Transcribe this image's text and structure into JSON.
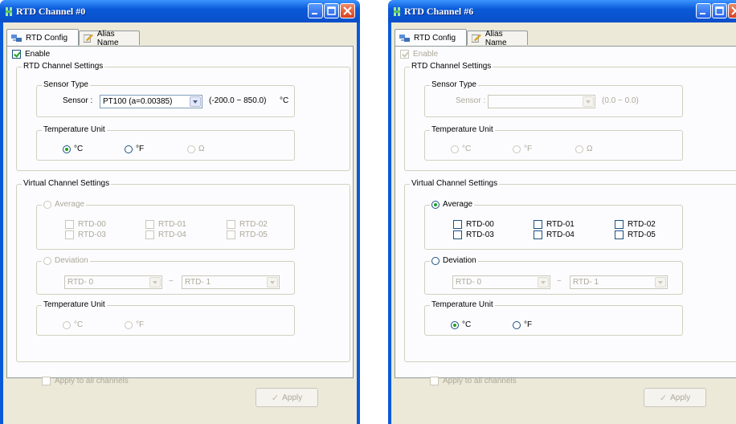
{
  "left_window": {
    "title": "RTD Channel #0",
    "tabs": [
      {
        "label": "RTD Config"
      },
      {
        "label": "Alias Name"
      }
    ],
    "enable_label": "Enable",
    "rtd_channel_settings": {
      "title": "RTD Channel Settings",
      "sensor_type": {
        "title": "Sensor Type",
        "sensor_label": "Sensor :",
        "sensor_value": "PT100 (a=0.00385)",
        "range": "(-200.0 ~ 850.0)",
        "unit": "°C"
      },
      "temperature_unit": {
        "title": "Temperature Unit",
        "options": [
          "°C",
          "°F",
          "Ω"
        ]
      }
    },
    "virtual_channel_settings": {
      "title": "Virtual Channel Settings",
      "average_label": "Average",
      "channels": [
        "RTD-00",
        "RTD-01",
        "RTD-02",
        "RTD-03",
        "RTD-04",
        "RTD-05"
      ],
      "deviation_label": "Deviation",
      "deviation_from": "RTD- 0",
      "deviation_separator": "~",
      "deviation_to": "RTD- 1",
      "temperature_unit": {
        "title": "Temperature Unit",
        "options": [
          "°C",
          "°F"
        ]
      }
    },
    "apply_all_label": "Apply to all channels",
    "apply_button": "Apply"
  },
  "right_window": {
    "title": "RTD Channel #6",
    "tabs": [
      {
        "label": "RTD Config"
      },
      {
        "label": "Alias Name"
      }
    ],
    "enable_label": "Enable",
    "rtd_channel_settings": {
      "title": "RTD Channel Settings",
      "sensor_type": {
        "title": "Sensor Type",
        "sensor_label": "Sensor :",
        "sensor_value": "",
        "range": "(0.0 ~ 0.0)"
      },
      "temperature_unit": {
        "title": "Temperature Unit",
        "options": [
          "°C",
          "°F",
          "Ω"
        ]
      }
    },
    "virtual_channel_settings": {
      "title": "Virtual Channel Settings",
      "average_label": "Average",
      "channels": [
        "RTD-00",
        "RTD-01",
        "RTD-02",
        "RTD-03",
        "RTD-04",
        "RTD-05"
      ],
      "deviation_label": "Deviation",
      "deviation_from": "RTD- 0",
      "deviation_separator": "~",
      "deviation_to": "RTD- 1",
      "temperature_unit": {
        "title": "Temperature Unit",
        "options": [
          "°C",
          "°F"
        ]
      }
    },
    "apply_all_label": "Apply to all channels",
    "apply_button": "Apply"
  },
  "colors": {
    "titlebar": "#0a5ad8",
    "dialog_bg": "#ece9d8",
    "disabled_text": "#aca899",
    "radio_dot": "#21a121"
  },
  "icons": [
    "app-icon",
    "minimize-icon",
    "maximize-icon",
    "close-icon",
    "network-config-icon",
    "edit-pencil-icon",
    "apply-check-icon"
  ]
}
